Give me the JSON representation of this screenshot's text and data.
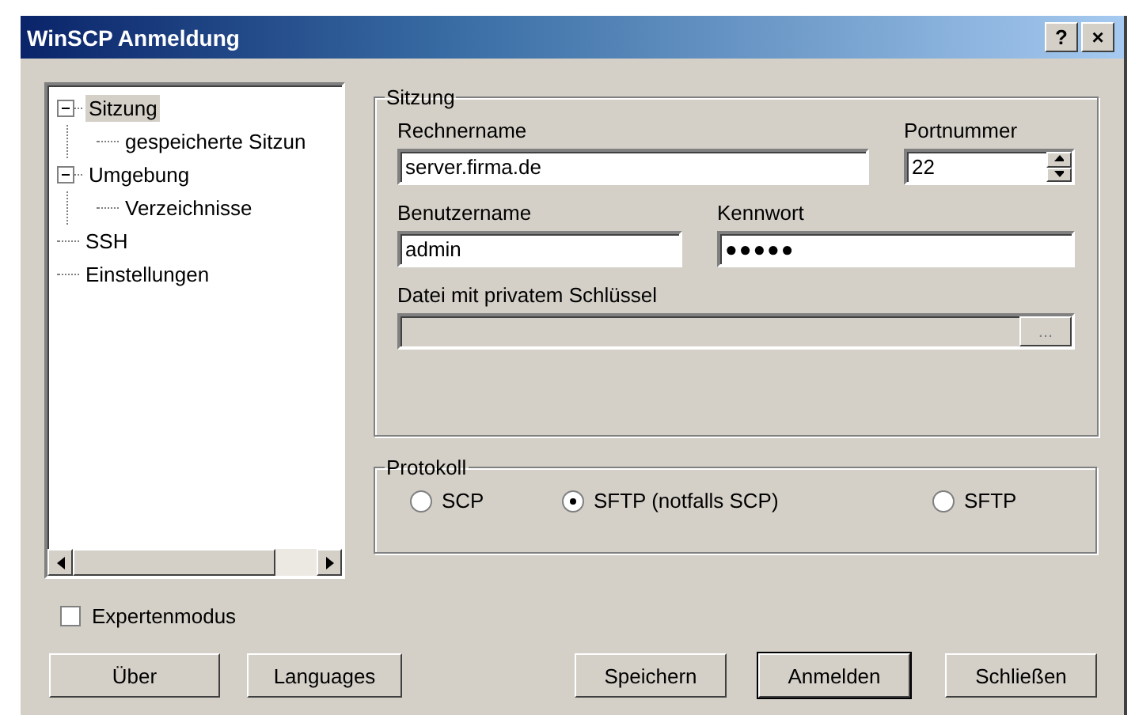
{
  "window": {
    "title": "WinSCP Anmeldung",
    "help_button": "?",
    "close_button": "×"
  },
  "tree": [
    {
      "label": "Sitzung",
      "selected": true,
      "expanded": true,
      "children": [
        {
          "label": "gespeicherte Sitzun",
          "selected": false
        }
      ]
    },
    {
      "label": "Umgebung",
      "selected": false,
      "expanded": true,
      "children": [
        {
          "label": "Verzeichnisse",
          "selected": false
        }
      ]
    },
    {
      "label": "SSH",
      "selected": false
    },
    {
      "label": "Einstellungen",
      "selected": false
    }
  ],
  "session": {
    "title": "Sitzung",
    "host": {
      "label": "Rechnername",
      "value": "server.firma.de"
    },
    "port": {
      "label": "Portnummer",
      "value": "22"
    },
    "user": {
      "label": "Benutzername",
      "value": "admin"
    },
    "password": {
      "label": "Kennwort",
      "value": "●●●●●"
    },
    "keyfile": {
      "label": "Datei mit privatem Schlüssel",
      "disabled": true,
      "browse_button": "..."
    }
  },
  "protocol": {
    "title": "Protokoll",
    "options": [
      {
        "label": "SCP",
        "selected": false
      },
      {
        "label": "SFTP (notfalls SCP)",
        "selected": true
      },
      {
        "label": "SFTP",
        "selected": false
      }
    ]
  },
  "expert_mode": {
    "label": "Expertenmodus",
    "checked": false
  },
  "buttons": [
    {
      "label": "Über",
      "default": false
    },
    {
      "label": "Languages",
      "default": false
    },
    {
      "label": "Speichern",
      "default": false
    },
    {
      "label": "Anmelden",
      "default": true
    },
    {
      "label": "Schließen",
      "default": false
    }
  ]
}
